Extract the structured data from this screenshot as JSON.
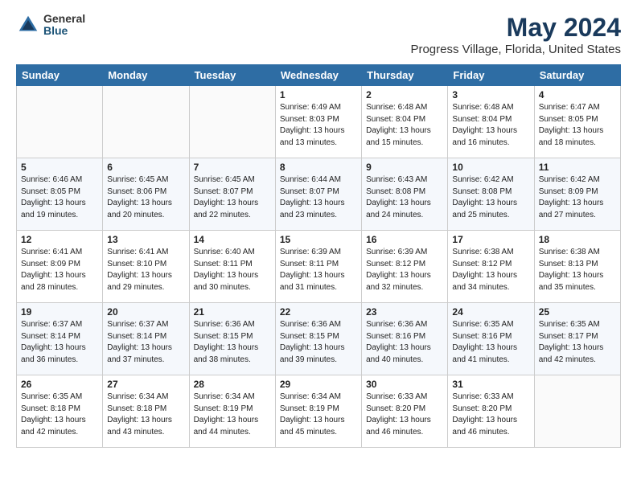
{
  "header": {
    "logo_general": "General",
    "logo_blue": "Blue",
    "month": "May 2024",
    "location": "Progress Village, Florida, United States"
  },
  "weekdays": [
    "Sunday",
    "Monday",
    "Tuesday",
    "Wednesday",
    "Thursday",
    "Friday",
    "Saturday"
  ],
  "weeks": [
    [
      {
        "day": "",
        "info": ""
      },
      {
        "day": "",
        "info": ""
      },
      {
        "day": "",
        "info": ""
      },
      {
        "day": "1",
        "info": "Sunrise: 6:49 AM\nSunset: 8:03 PM\nDaylight: 13 hours\nand 13 minutes."
      },
      {
        "day": "2",
        "info": "Sunrise: 6:48 AM\nSunset: 8:04 PM\nDaylight: 13 hours\nand 15 minutes."
      },
      {
        "day": "3",
        "info": "Sunrise: 6:48 AM\nSunset: 8:04 PM\nDaylight: 13 hours\nand 16 minutes."
      },
      {
        "day": "4",
        "info": "Sunrise: 6:47 AM\nSunset: 8:05 PM\nDaylight: 13 hours\nand 18 minutes."
      }
    ],
    [
      {
        "day": "5",
        "info": "Sunrise: 6:46 AM\nSunset: 8:05 PM\nDaylight: 13 hours\nand 19 minutes."
      },
      {
        "day": "6",
        "info": "Sunrise: 6:45 AM\nSunset: 8:06 PM\nDaylight: 13 hours\nand 20 minutes."
      },
      {
        "day": "7",
        "info": "Sunrise: 6:45 AM\nSunset: 8:07 PM\nDaylight: 13 hours\nand 22 minutes."
      },
      {
        "day": "8",
        "info": "Sunrise: 6:44 AM\nSunset: 8:07 PM\nDaylight: 13 hours\nand 23 minutes."
      },
      {
        "day": "9",
        "info": "Sunrise: 6:43 AM\nSunset: 8:08 PM\nDaylight: 13 hours\nand 24 minutes."
      },
      {
        "day": "10",
        "info": "Sunrise: 6:42 AM\nSunset: 8:08 PM\nDaylight: 13 hours\nand 25 minutes."
      },
      {
        "day": "11",
        "info": "Sunrise: 6:42 AM\nSunset: 8:09 PM\nDaylight: 13 hours\nand 27 minutes."
      }
    ],
    [
      {
        "day": "12",
        "info": "Sunrise: 6:41 AM\nSunset: 8:09 PM\nDaylight: 13 hours\nand 28 minutes."
      },
      {
        "day": "13",
        "info": "Sunrise: 6:41 AM\nSunset: 8:10 PM\nDaylight: 13 hours\nand 29 minutes."
      },
      {
        "day": "14",
        "info": "Sunrise: 6:40 AM\nSunset: 8:11 PM\nDaylight: 13 hours\nand 30 minutes."
      },
      {
        "day": "15",
        "info": "Sunrise: 6:39 AM\nSunset: 8:11 PM\nDaylight: 13 hours\nand 31 minutes."
      },
      {
        "day": "16",
        "info": "Sunrise: 6:39 AM\nSunset: 8:12 PM\nDaylight: 13 hours\nand 32 minutes."
      },
      {
        "day": "17",
        "info": "Sunrise: 6:38 AM\nSunset: 8:12 PM\nDaylight: 13 hours\nand 34 minutes."
      },
      {
        "day": "18",
        "info": "Sunrise: 6:38 AM\nSunset: 8:13 PM\nDaylight: 13 hours\nand 35 minutes."
      }
    ],
    [
      {
        "day": "19",
        "info": "Sunrise: 6:37 AM\nSunset: 8:14 PM\nDaylight: 13 hours\nand 36 minutes."
      },
      {
        "day": "20",
        "info": "Sunrise: 6:37 AM\nSunset: 8:14 PM\nDaylight: 13 hours\nand 37 minutes."
      },
      {
        "day": "21",
        "info": "Sunrise: 6:36 AM\nSunset: 8:15 PM\nDaylight: 13 hours\nand 38 minutes."
      },
      {
        "day": "22",
        "info": "Sunrise: 6:36 AM\nSunset: 8:15 PM\nDaylight: 13 hours\nand 39 minutes."
      },
      {
        "day": "23",
        "info": "Sunrise: 6:36 AM\nSunset: 8:16 PM\nDaylight: 13 hours\nand 40 minutes."
      },
      {
        "day": "24",
        "info": "Sunrise: 6:35 AM\nSunset: 8:16 PM\nDaylight: 13 hours\nand 41 minutes."
      },
      {
        "day": "25",
        "info": "Sunrise: 6:35 AM\nSunset: 8:17 PM\nDaylight: 13 hours\nand 42 minutes."
      }
    ],
    [
      {
        "day": "26",
        "info": "Sunrise: 6:35 AM\nSunset: 8:18 PM\nDaylight: 13 hours\nand 42 minutes."
      },
      {
        "day": "27",
        "info": "Sunrise: 6:34 AM\nSunset: 8:18 PM\nDaylight: 13 hours\nand 43 minutes."
      },
      {
        "day": "28",
        "info": "Sunrise: 6:34 AM\nSunset: 8:19 PM\nDaylight: 13 hours\nand 44 minutes."
      },
      {
        "day": "29",
        "info": "Sunrise: 6:34 AM\nSunset: 8:19 PM\nDaylight: 13 hours\nand 45 minutes."
      },
      {
        "day": "30",
        "info": "Sunrise: 6:33 AM\nSunset: 8:20 PM\nDaylight: 13 hours\nand 46 minutes."
      },
      {
        "day": "31",
        "info": "Sunrise: 6:33 AM\nSunset: 8:20 PM\nDaylight: 13 hours\nand 46 minutes."
      },
      {
        "day": "",
        "info": ""
      }
    ]
  ]
}
